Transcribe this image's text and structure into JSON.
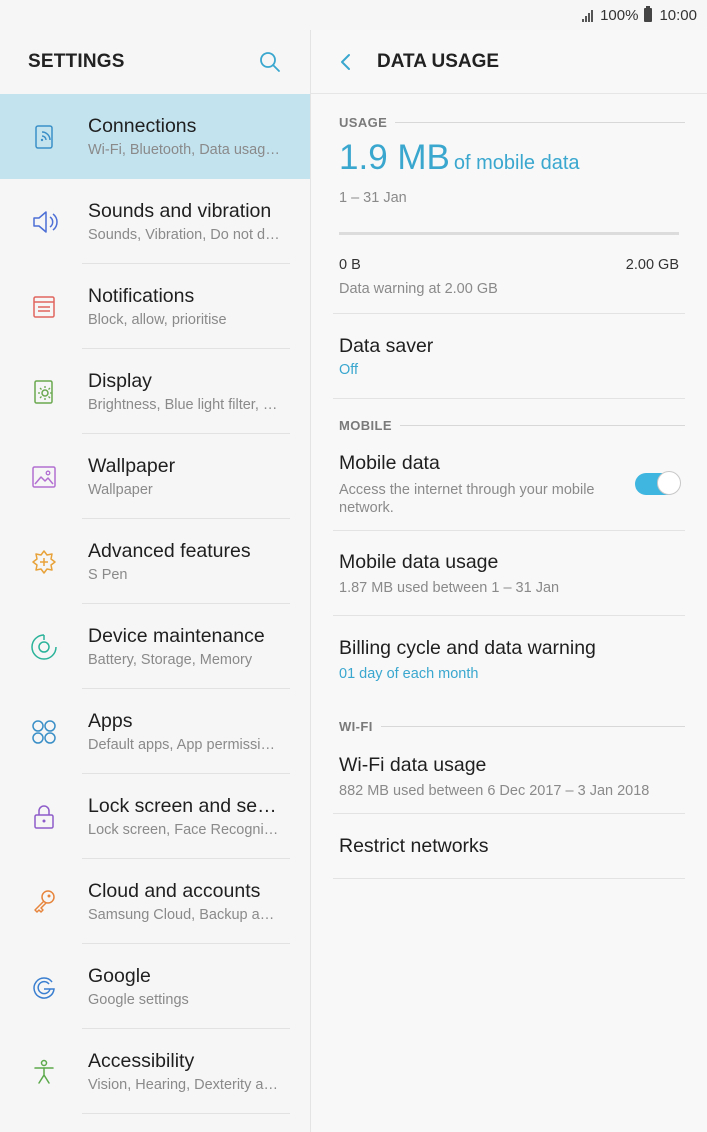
{
  "status_bar": {
    "battery": "100%",
    "time": "10:00"
  },
  "left_pane": {
    "title": "SETTINGS",
    "items": [
      {
        "label": "Connections",
        "sub": "Wi-Fi, Bluetooth, Data usage, Flight mode",
        "icon": "connections-icon",
        "color": "#3a8fc7",
        "active": true
      },
      {
        "label": "Sounds and vibration",
        "sub": "Sounds, Vibration, Do not disturb",
        "icon": "speaker-icon",
        "color": "#4d6fd6"
      },
      {
        "label": "Notifications",
        "sub": "Block, allow, prioritise",
        "icon": "notifications-icon",
        "color": "#e0655e"
      },
      {
        "label": "Display",
        "sub": "Brightness, Blue light filter, Home screen",
        "icon": "display-brightness-icon",
        "color": "#6aa84f"
      },
      {
        "label": "Wallpaper",
        "sub": "Wallpaper",
        "icon": "wallpaper-icon",
        "color": "#b26fd1"
      },
      {
        "label": "Advanced features",
        "sub": "S Pen",
        "icon": "advanced-features-icon",
        "color": "#e8a23a"
      },
      {
        "label": "Device maintenance",
        "sub": "Battery, Storage, Memory",
        "icon": "device-maintenance-icon",
        "color": "#2bb39a"
      },
      {
        "label": "Apps",
        "sub": "Default apps, App permissions",
        "icon": "apps-icon",
        "color": "#3a8fc7"
      },
      {
        "label": "Lock screen and security",
        "sub": "Lock screen, Face Recognition",
        "icon": "lock-icon",
        "color": "#8e5cc9"
      },
      {
        "label": "Cloud and accounts",
        "sub": "Samsung Cloud, Backup and restore",
        "icon": "key-icon",
        "color": "#e7853d"
      },
      {
        "label": "Google",
        "sub": "Google settings",
        "icon": "google-icon",
        "color": "#3a7fd0"
      },
      {
        "label": "Accessibility",
        "sub": "Vision, Hearing, Dexterity and interaction",
        "icon": "accessibility-icon",
        "color": "#5ba94a"
      }
    ]
  },
  "right_pane": {
    "title": "DATA USAGE",
    "usage_section": "USAGE",
    "usage_amount": "1.9 MB",
    "usage_suffix": "of mobile data",
    "period": "1 – 31 Jan",
    "range_min": "0 B",
    "range_max": "2.00 GB",
    "warning_text": "Data warning at 2.00 GB",
    "data_saver": {
      "label": "Data saver",
      "value": "Off"
    },
    "mobile_section": "MOBILE",
    "mobile_data": {
      "label": "Mobile data",
      "desc": "Access the internet through your mobile network.",
      "enabled": true
    },
    "mobile_data_usage": {
      "label": "Mobile data usage",
      "desc": "1.87 MB used between 1 – 31 Jan"
    },
    "billing": {
      "label": "Billing cycle and data warning",
      "desc": "01 day of each month"
    },
    "wifi_section": "WI-FI",
    "wifi_data_usage": {
      "label": "Wi-Fi data usage",
      "desc": "882 MB used between 6 Dec 2017 – 3 Jan 2018"
    },
    "restrict_networks": {
      "label": "Restrict networks"
    }
  },
  "colors": {
    "accent": "#3aa7cf",
    "active_row": "#c3e3ef",
    "toggle_on": "#3fb6e0"
  }
}
